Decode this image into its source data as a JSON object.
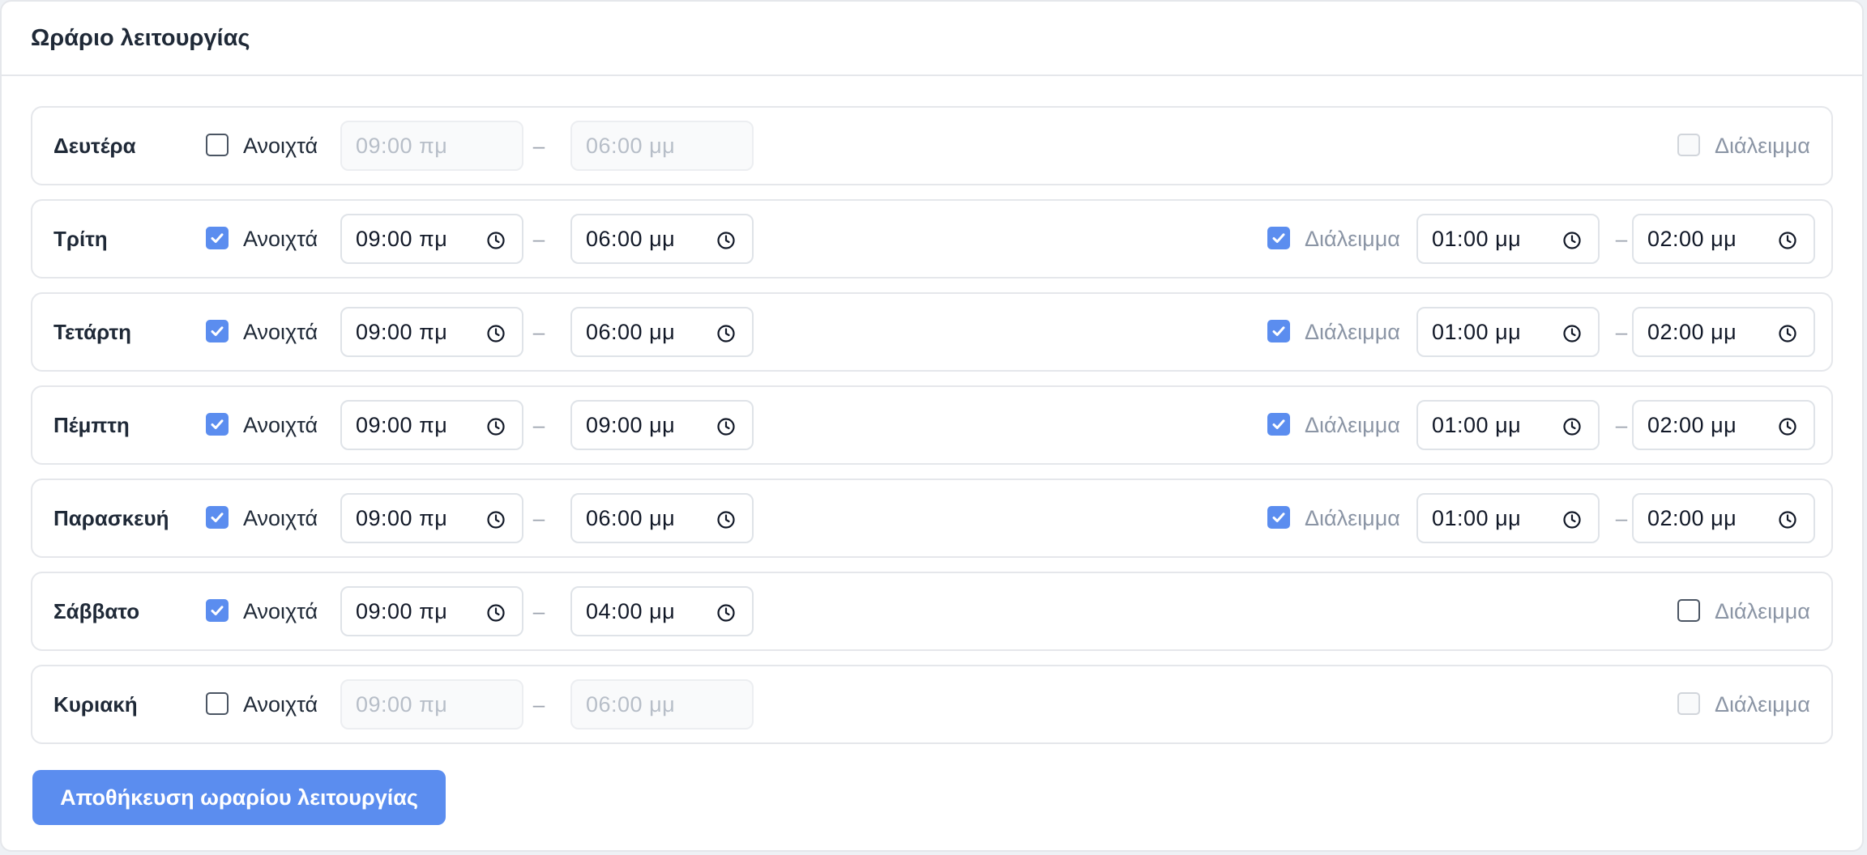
{
  "header": {
    "title": "Ωράριο λειτουργίας"
  },
  "labels": {
    "open": "Ανοιχτά",
    "break": "Διάλειμμα",
    "dash": "–"
  },
  "days": [
    {
      "name": "Δευτέρα",
      "open": false,
      "from": "09:00 πμ",
      "to": "06:00 μμ",
      "break_enabled": false,
      "break_checked": false
    },
    {
      "name": "Τρίτη",
      "open": true,
      "from": "09:00 πμ",
      "to": "06:00 μμ",
      "break_enabled": true,
      "break_checked": true,
      "break_from": "01:00 μμ",
      "break_to": "02:00 μμ"
    },
    {
      "name": "Τετάρτη",
      "open": true,
      "from": "09:00 πμ",
      "to": "06:00 μμ",
      "break_enabled": true,
      "break_checked": true,
      "break_from": "01:00 μμ",
      "break_to": "02:00 μμ"
    },
    {
      "name": "Πέμπτη",
      "open": true,
      "from": "09:00 πμ",
      "to": "09:00 μμ",
      "break_enabled": true,
      "break_checked": true,
      "break_from": "01:00 μμ",
      "break_to": "02:00 μμ"
    },
    {
      "name": "Παρασκευή",
      "open": true,
      "from": "09:00 πμ",
      "to": "06:00 μμ",
      "break_enabled": true,
      "break_checked": true,
      "break_from": "01:00 μμ",
      "break_to": "02:00 μμ"
    },
    {
      "name": "Σάββατο",
      "open": true,
      "from": "09:00 πμ",
      "to": "04:00 μμ",
      "break_enabled": true,
      "break_checked": false
    },
    {
      "name": "Κυριακή",
      "open": false,
      "from": "09:00 πμ",
      "to": "06:00 μμ",
      "break_enabled": false,
      "break_checked": false
    }
  ],
  "save_button": {
    "label": "Αποθήκευση ωραρίου λειτουργίας"
  },
  "colors": {
    "accent": "#5b8def",
    "border": "#e5e7eb",
    "muted_text": "#8b95a5"
  }
}
